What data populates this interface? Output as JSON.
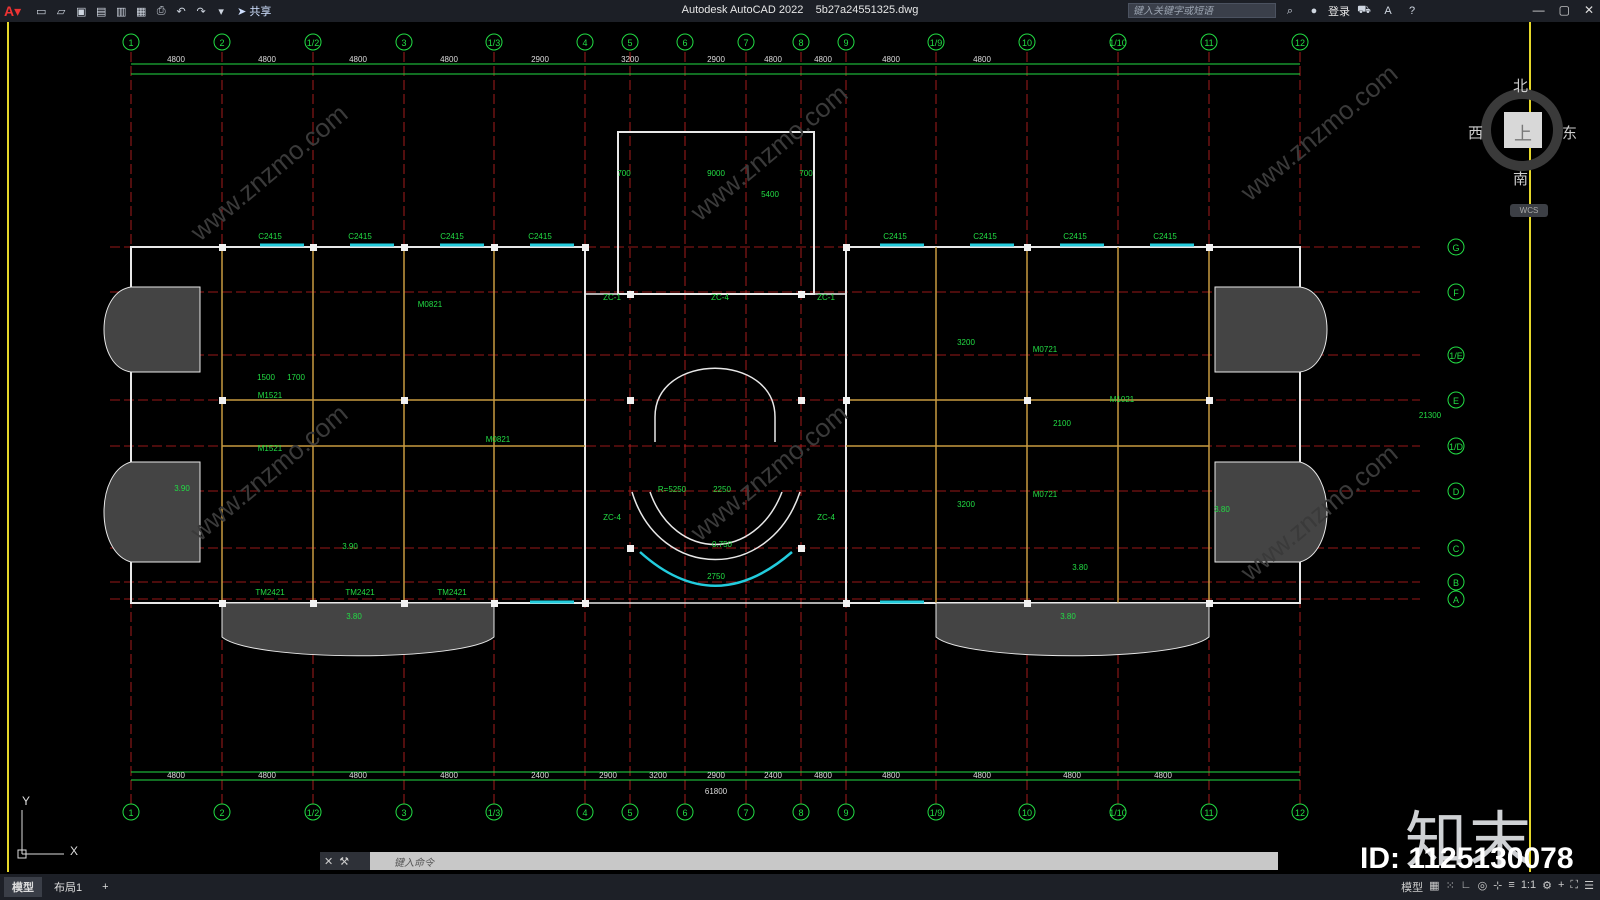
{
  "app": {
    "title": "Autodesk AutoCAD 2022",
    "file": "5b27a24551325.dwg",
    "share_label": "共享",
    "search_placeholder": "键入关键字或短语",
    "login_label": "登录"
  },
  "viewcube": {
    "north": "北",
    "south": "南",
    "west": "西",
    "east": "东",
    "top": "上",
    "wcs": "WCS"
  },
  "watermark": {
    "brand": "知末",
    "id": "ID: 1125130078",
    "site": "www.znzmo.com"
  },
  "command": {
    "placeholder": "键入命令"
  },
  "status": {
    "tabs": [
      "模型",
      "布局1"
    ],
    "add_tab": "+",
    "model_label": "模型",
    "scale": "1:1"
  },
  "ucs": {
    "x": "X",
    "y": "Y"
  },
  "drawing": {
    "grid_top": [
      "1",
      "2",
      "1/2",
      "3",
      "1/3",
      "4",
      "5",
      "6",
      "7",
      "8",
      "9",
      "1/9",
      "10",
      "1/10",
      "11",
      "12"
    ],
    "grid_right": [
      "G",
      "F",
      "1/E",
      "E",
      "1/D",
      "D",
      "C",
      "B",
      "A"
    ],
    "top_dims": [
      "4800",
      "4800",
      "4800",
      "4800",
      "2900",
      "3200",
      "2900",
      "4800",
      "4800",
      "4800",
      "4800"
    ],
    "bottom_dims": [
      "4800",
      "4800",
      "4800",
      "4800",
      "2400",
      "2900",
      "3200",
      "2900",
      "2400",
      "4800",
      "4800",
      "4800",
      "4800",
      "4800"
    ],
    "total": "61800",
    "labels": [
      "C2415",
      "C2415",
      "C2415",
      "C2415",
      "C2415",
      "C2415",
      "C2415",
      "C2415",
      "M1521",
      "M1521",
      "M0821",
      "M0821",
      "M0721",
      "M0721",
      "M1021",
      "TM2421",
      "TM2421",
      "TM2421",
      "ZC-1",
      "ZC-4",
      "ZC-1",
      "ZC-4",
      "ZC-4",
      "3.90",
      "3.90",
      "3.80",
      "3.80",
      "3.80",
      "3.80",
      "R=5250",
      "0.750",
      "9000",
      "5400",
      "700",
      "700",
      "2250",
      "2750",
      "3200",
      "3200",
      "1500",
      "1700",
      "2100",
      "21300"
    ]
  },
  "colors": {
    "bg": "#000000",
    "grid_axis": "#cc2222",
    "dim": "#22dd44",
    "wall": "#e8e8e8",
    "window": "#22ccdd",
    "text_label": "#22dd44",
    "titlebar": "#1c1f26"
  }
}
